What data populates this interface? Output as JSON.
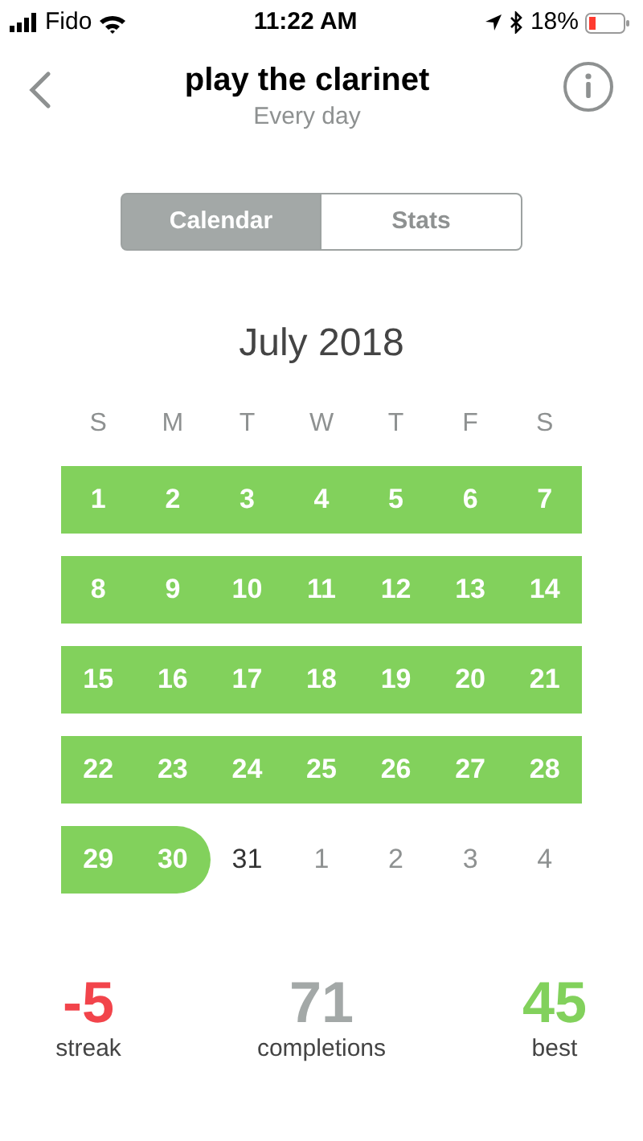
{
  "status_bar": {
    "carrier": "Fido",
    "time": "11:22 AM",
    "battery": "18%"
  },
  "header": {
    "title": "play the clarinet",
    "subtitle": "Every day"
  },
  "segments": [
    {
      "label": "Calendar",
      "selected": true
    },
    {
      "label": "Stats",
      "selected": false
    }
  ],
  "calendar": {
    "month": "July 2018",
    "weekdays": [
      "S",
      "M",
      "T",
      "W",
      "T",
      "F",
      "S"
    ],
    "weeks": [
      [
        {
          "label": "1",
          "done": true,
          "kind": "current"
        },
        {
          "label": "2",
          "done": true,
          "kind": "current"
        },
        {
          "label": "3",
          "done": true,
          "kind": "current"
        },
        {
          "label": "4",
          "done": true,
          "kind": "current"
        },
        {
          "label": "5",
          "done": true,
          "kind": "current"
        },
        {
          "label": "6",
          "done": true,
          "kind": "current"
        },
        {
          "label": "7",
          "done": true,
          "kind": "current"
        }
      ],
      [
        {
          "label": "8",
          "done": true,
          "kind": "current"
        },
        {
          "label": "9",
          "done": true,
          "kind": "current"
        },
        {
          "label": "10",
          "done": true,
          "kind": "current"
        },
        {
          "label": "11",
          "done": true,
          "kind": "current"
        },
        {
          "label": "12",
          "done": true,
          "kind": "current"
        },
        {
          "label": "13",
          "done": true,
          "kind": "current"
        },
        {
          "label": "14",
          "done": true,
          "kind": "current"
        }
      ],
      [
        {
          "label": "15",
          "done": true,
          "kind": "current"
        },
        {
          "label": "16",
          "done": true,
          "kind": "current"
        },
        {
          "label": "17",
          "done": true,
          "kind": "current"
        },
        {
          "label": "18",
          "done": true,
          "kind": "current"
        },
        {
          "label": "19",
          "done": true,
          "kind": "current"
        },
        {
          "label": "20",
          "done": true,
          "kind": "current"
        },
        {
          "label": "21",
          "done": true,
          "kind": "current"
        }
      ],
      [
        {
          "label": "22",
          "done": true,
          "kind": "current"
        },
        {
          "label": "23",
          "done": true,
          "kind": "current"
        },
        {
          "label": "24",
          "done": true,
          "kind": "current"
        },
        {
          "label": "25",
          "done": true,
          "kind": "current"
        },
        {
          "label": "26",
          "done": true,
          "kind": "current"
        },
        {
          "label": "27",
          "done": true,
          "kind": "current"
        },
        {
          "label": "28",
          "done": true,
          "kind": "current"
        }
      ],
      [
        {
          "label": "29",
          "done": true,
          "kind": "current"
        },
        {
          "label": "30",
          "done": true,
          "kind": "current"
        },
        {
          "label": "31",
          "done": false,
          "kind": "current"
        },
        {
          "label": "1",
          "done": false,
          "kind": "other"
        },
        {
          "label": "2",
          "done": false,
          "kind": "other"
        },
        {
          "label": "3",
          "done": false,
          "kind": "other"
        },
        {
          "label": "4",
          "done": false,
          "kind": "other"
        }
      ]
    ]
  },
  "stats": [
    {
      "value": "-5",
      "label": "streak",
      "color": "#f2444b"
    },
    {
      "value": "71",
      "label": "completions",
      "color": "#a3a8a7"
    },
    {
      "value": "45",
      "label": "best",
      "color": "#82d15c"
    }
  ]
}
